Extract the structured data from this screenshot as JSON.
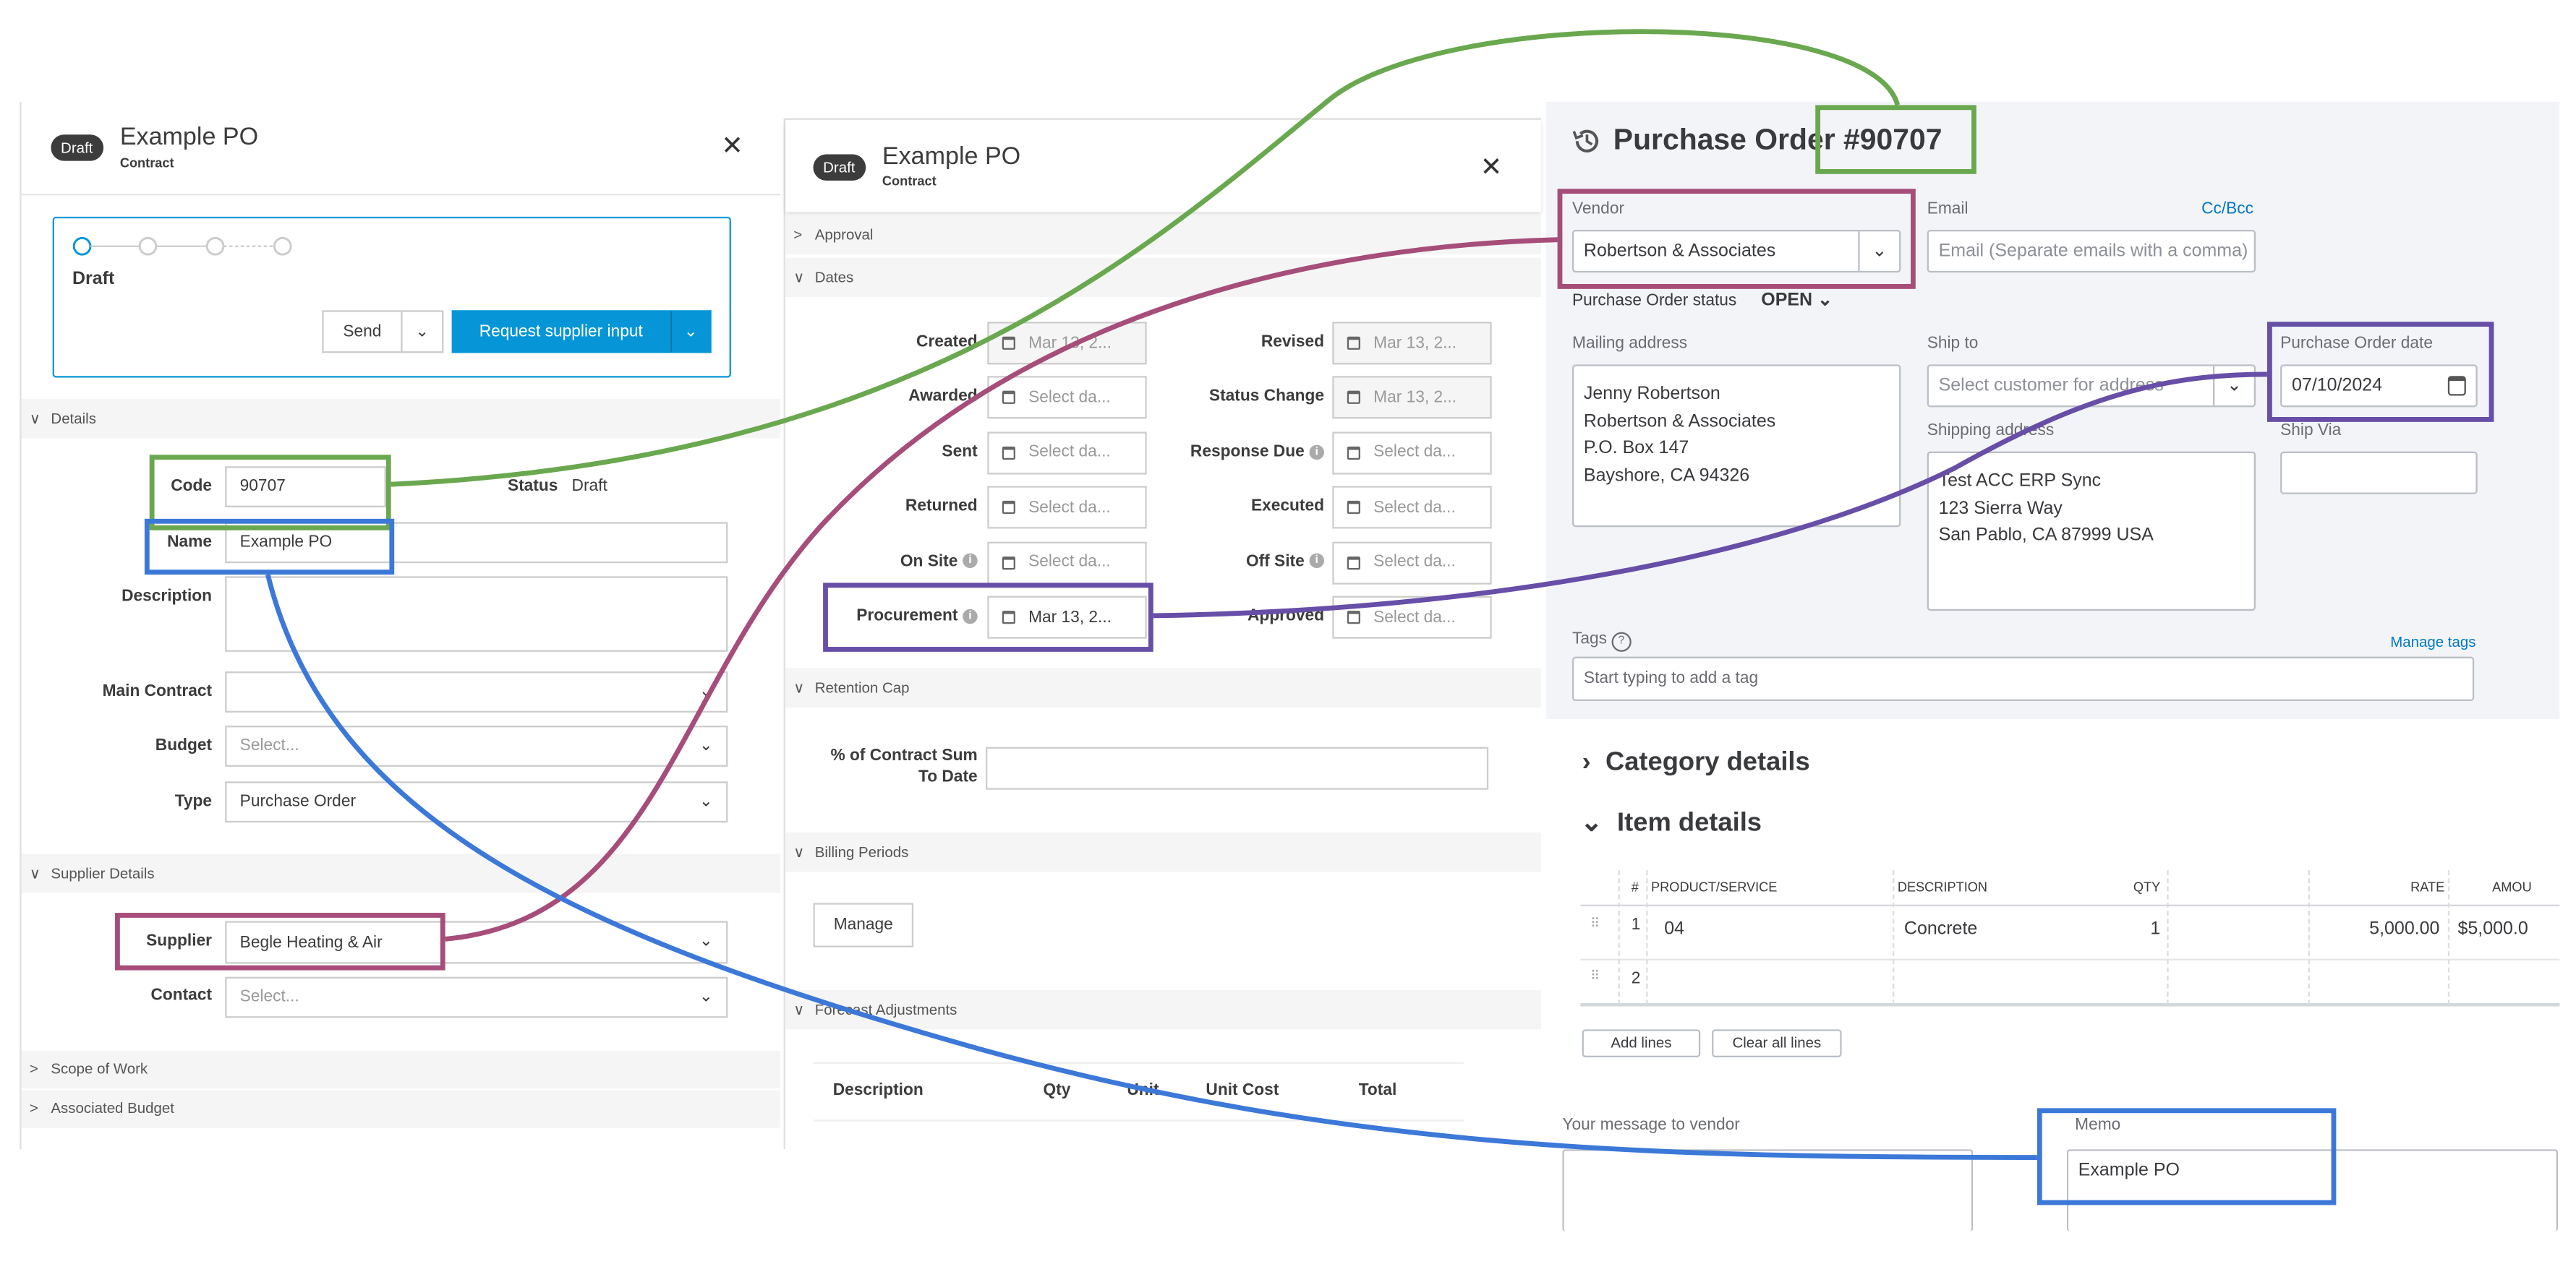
{
  "colors": {
    "green": "#6aa84f",
    "blue": "#3c78d8",
    "magenta": "#a64d79",
    "purple": "#674ea7",
    "accent": "#0696d7",
    "qb_bg": "#f3f4f8"
  },
  "panel1": {
    "badge": "Draft",
    "title": "Example PO",
    "subtitle": "Contract",
    "stepper": {
      "current": "Draft",
      "steps_total": 4,
      "current_step": 1
    },
    "send_label": "Send",
    "request_label": "Request supplier input",
    "details_section": "Details",
    "code_label": "Code",
    "code_value": "90707",
    "status_label": "Status",
    "status_value": "Draft",
    "name_label": "Name",
    "name_value": "Example PO",
    "description_label": "Description",
    "main_contract_label": "Main Contract",
    "budget_label": "Budget",
    "budget_placeholder": "Select...",
    "type_label": "Type",
    "type_value": "Purchase Order",
    "supplier_section": "Supplier Details",
    "supplier_label": "Supplier",
    "supplier_value": "Begle Heating & Air",
    "contact_label": "Contact",
    "contact_placeholder": "Select...",
    "scope_section": "Scope of Work",
    "assoc_budget_section": "Associated Budget"
  },
  "panel2": {
    "badge": "Draft",
    "title": "Example PO",
    "subtitle": "Contract",
    "approval_section": "Approval",
    "dates_section": "Dates",
    "dates": [
      {
        "l_label": "Created",
        "l_value": "Mar 13, 2...",
        "l_state": "disabled",
        "r_label": "Revised",
        "r_value": "Mar 13, 2...",
        "r_state": "disabled"
      },
      {
        "l_label": "Awarded",
        "l_value": "Select da...",
        "l_state": "placeholder",
        "r_label": "Status Change",
        "r_value": "Mar 13, 2...",
        "r_state": "disabled"
      },
      {
        "l_label": "Sent",
        "l_value": "Select da...",
        "l_state": "placeholder",
        "r_label": "Response Due",
        "r_info": true,
        "r_value": "Select da...",
        "r_state": "placeholder"
      },
      {
        "l_label": "Returned",
        "l_value": "Select da...",
        "l_state": "placeholder",
        "r_label": "Executed",
        "r_value": "Select da...",
        "r_state": "placeholder"
      },
      {
        "l_label": "On Site",
        "l_info": true,
        "l_value": "Select da...",
        "l_state": "placeholder",
        "r_label": "Off Site",
        "r_info": true,
        "r_value": "Select da...",
        "r_state": "placeholder"
      },
      {
        "l_label": "Procurement",
        "l_info": true,
        "l_value": "Mar 13, 2...",
        "l_state": "filled",
        "r_label": "Approved",
        "r_value": "Select da...",
        "r_state": "placeholder"
      }
    ],
    "retention_section": "Retention Cap",
    "retention_label_1": "% of Contract Sum",
    "retention_label_2": "To Date",
    "billing_section": "Billing Periods",
    "manage_label": "Manage",
    "forecast_section": "Forecast Adjustments",
    "forecast_columns": [
      "Description",
      "Qty",
      "Unit",
      "Unit Cost",
      "Total"
    ]
  },
  "panel3": {
    "title": "Purchase Order #90707",
    "vendor_label": "Vendor",
    "vendor_value": "Robertson & Associates",
    "email_label": "Email",
    "cc_bcc": "Cc/Bcc",
    "email_placeholder": "Email (Separate emails with a comma)",
    "status_label": "Purchase Order status",
    "status_value": "OPEN",
    "mailing_label": "Mailing address",
    "mailing_lines": [
      "Jenny Robertson",
      "Robertson & Associates",
      "P.O. Box 147",
      "Bayshore, CA  94326"
    ],
    "ship_to_label": "Ship to",
    "ship_to_placeholder": "Select customer for address",
    "shipping_label": "Shipping address",
    "shipping_lines": [
      "Test ACC ERP Sync",
      "123 Sierra Way",
      "San Pablo, CA  87999 USA"
    ],
    "po_date_label": "Purchase Order date",
    "po_date_value": "07/10/2024",
    "ship_via_label": "Ship Via",
    "tags_label": "Tags",
    "manage_tags": "Manage tags",
    "tags_placeholder": "Start typing to add a tag",
    "category_details": "Category details",
    "item_details": "Item details",
    "columns": [
      "#",
      "PRODUCT/SERVICE",
      "DESCRIPTION",
      "QTY",
      "RATE",
      "AMOU"
    ],
    "rows": [
      {
        "num": "1",
        "product": "04",
        "description": "Concrete",
        "qty": "1",
        "rate": "5,000.00",
        "amount": "$5,000.0"
      },
      {
        "num": "2",
        "product": "",
        "description": "",
        "qty": "",
        "rate": "",
        "amount": ""
      }
    ],
    "add_lines": "Add lines",
    "clear_lines": "Clear all lines",
    "message_label": "Your message to vendor",
    "memo_label": "Memo",
    "memo_value": "Example PO"
  }
}
